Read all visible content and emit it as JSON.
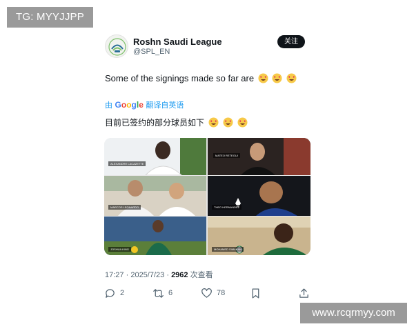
{
  "watermarks": {
    "top": "TG: MYYJJPP",
    "bottom": "www.rcqrmyy.com"
  },
  "author": {
    "name": "Roshn Saudi League",
    "handle": "@SPL_EN",
    "avatar_icon": "spl-logo-icon"
  },
  "follow_label": "关注",
  "tweet": {
    "text": "Some of the signings made so far are",
    "emoji": [
      "heart-eyes-emoji",
      "heart-eyes-emoji",
      "heart-eyes-emoji"
    ]
  },
  "translation": {
    "prefix": "由",
    "brand": "Google",
    "label": "翻译自英语",
    "text": "目前已签约的部分球员如下"
  },
  "media": {
    "players": [
      "ALEXANDRE LACAZETTE",
      "MARCOS LEONARDO",
      "JOSHUA KING",
      "MATEO RETEGUI",
      "THEO HERNANDEZ",
      "MOHAMED SIMAKAN"
    ]
  },
  "meta": {
    "time": "17:27",
    "sep": "·",
    "date": "2025/7/23",
    "sep2": "·",
    "views": "2962",
    "views_label": "次查看"
  },
  "actions": {
    "reply_count": "2",
    "retweet_count": "6",
    "like_count": "78"
  },
  "colors": {
    "accent": "#1d9bf0",
    "text": "#0f1419",
    "muted": "#536471",
    "emoji": "#f7c948",
    "heart": "#e0245e"
  }
}
